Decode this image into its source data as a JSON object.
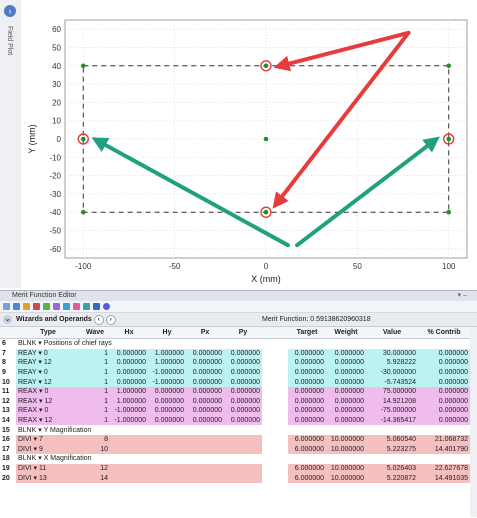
{
  "side_panel": {
    "label": "Field Plot"
  },
  "plot": {
    "xlabel": "X (mm)",
    "ylabel": "Y (mm)",
    "x_ticks": [
      "-100",
      "-50",
      "0",
      "50",
      "100"
    ],
    "y_ticks": [
      "60",
      "50",
      "40",
      "30",
      "20",
      "10",
      "0",
      "-10",
      "-20",
      "-30",
      "-40",
      "-50",
      "-60"
    ],
    "colors": {
      "points": "#1e8f2a",
      "circles": "#e23b3b",
      "red_arrow": "#e83c3c",
      "teal_arrow": "#20a07e"
    }
  },
  "chart_data": {
    "type": "scatter",
    "xlabel": "X (mm)",
    "ylabel": "Y (mm)",
    "xlim": [
      -110,
      110
    ],
    "ylim": [
      -65,
      65
    ],
    "points": [
      {
        "x": -100,
        "y": 40
      },
      {
        "x": 100,
        "y": 40
      },
      {
        "x": -100,
        "y": -40
      },
      {
        "x": 100,
        "y": -40
      },
      {
        "x": 0,
        "y": 0
      },
      {
        "x": -100,
        "y": 0
      },
      {
        "x": 100,
        "y": 0
      },
      {
        "x": 0,
        "y": 40
      },
      {
        "x": 0,
        "y": -40
      }
    ],
    "circled_points": [
      {
        "x": 0,
        "y": 40
      },
      {
        "x": 0,
        "y": -40
      },
      {
        "x": -100,
        "y": 0
      },
      {
        "x": 100,
        "y": 0
      }
    ],
    "dashed_rectangle": {
      "x": [
        -100,
        100
      ],
      "y": [
        -40,
        40
      ]
    },
    "grid": true
  },
  "editor": {
    "title": "Merit Function Editor",
    "wizard_label": "Wizards and Operands",
    "merit_label": "Merit Function:",
    "merit_value": "0.59138620960318",
    "headers": [
      "Type",
      "Wave",
      "Hx",
      "Hy",
      "Px",
      "Py",
      "Target",
      "Weight",
      "Value",
      "% Contrib"
    ],
    "rows": [
      {
        "n": "6",
        "kind": "blnk",
        "text": "BLNK ▾ Positions of chief rays"
      },
      {
        "n": "7",
        "kind": "cyan",
        "type": "REAY ▾ 0",
        "wave": "1",
        "hx": "0.000000",
        "hy": "1.000000",
        "px": "0.000000",
        "py": "0.000000",
        "target": "0.000000",
        "weight": "0.000000",
        "value": "30.000000",
        "contrib": "0.000000"
      },
      {
        "n": "8",
        "kind": "cyan",
        "type": "REAY ▾ 12",
        "wave": "1",
        "hx": "0.000000",
        "hy": "1.000000",
        "px": "0.000000",
        "py": "0.000000",
        "target": "0.000000",
        "weight": "0.000000",
        "value": "5.928222",
        "contrib": "0.000000"
      },
      {
        "n": "9",
        "kind": "cyan",
        "type": "REAY ▾ 0",
        "wave": "1",
        "hx": "0.000000",
        "hy": "-1.000000",
        "px": "0.000000",
        "py": "0.000000",
        "target": "0.000000",
        "weight": "0.000000",
        "value": "-30.000000",
        "contrib": "0.000000"
      },
      {
        "n": "10",
        "kind": "cyan",
        "type": "REAY ▾ 12",
        "wave": "1",
        "hx": "0.000000",
        "hy": "-1.000000",
        "px": "0.000000",
        "py": "0.000000",
        "target": "0.000000",
        "weight": "0.000000",
        "value": "-5.743524",
        "contrib": "0.000000"
      },
      {
        "n": "11",
        "kind": "mag",
        "type": "REAX ▾ 0",
        "wave": "1",
        "hx": "1.000000",
        "hy": "0.000000",
        "px": "0.000000",
        "py": "0.000000",
        "target": "0.000000",
        "weight": "0.000000",
        "value": "75.000000",
        "contrib": "0.000000"
      },
      {
        "n": "12",
        "kind": "mag",
        "type": "REAX ▾ 12",
        "wave": "1",
        "hx": "1.000000",
        "hy": "0.000000",
        "px": "0.000000",
        "py": "0.000000",
        "target": "0.000000",
        "weight": "0.000000",
        "value": "14.921208",
        "contrib": "0.000000"
      },
      {
        "n": "13",
        "kind": "mag",
        "type": "REAX ▾ 0",
        "wave": "1",
        "hx": "-1.000000",
        "hy": "0.000000",
        "px": "0.000000",
        "py": "0.000000",
        "target": "0.000000",
        "weight": "0.000000",
        "value": "-75.000000",
        "contrib": "0.000000"
      },
      {
        "n": "14",
        "kind": "mag",
        "type": "REAX ▾ 12",
        "wave": "1",
        "hx": "-1.000000",
        "hy": "0.000000",
        "px": "0.000000",
        "py": "0.000000",
        "target": "0.000000",
        "weight": "0.000000",
        "value": "-14.365417",
        "contrib": "0.000000"
      },
      {
        "n": "15",
        "kind": "blnk",
        "text": "BLNK ▾ Y Magnification"
      },
      {
        "n": "16",
        "kind": "pink",
        "type": "DIVI ▾ 7",
        "wave": "8",
        "hx": "",
        "hy": "",
        "px": "",
        "py": "",
        "target": "6.000000",
        "weight": "10.000000",
        "value": "5.060540",
        "contrib": "21.068732"
      },
      {
        "n": "17",
        "kind": "pink",
        "type": "DIVI ▾ 9",
        "wave": "10",
        "hx": "",
        "hy": "",
        "px": "",
        "py": "",
        "target": "6.000000",
        "weight": "10.000000",
        "value": "5.223275",
        "contrib": "14.401790"
      },
      {
        "n": "18",
        "kind": "blnk",
        "text": "BLNK ▾ X Magnification"
      },
      {
        "n": "19",
        "kind": "pink",
        "type": "DIVI ▾ 11",
        "wave": "12",
        "hx": "",
        "hy": "",
        "px": "",
        "py": "",
        "target": "6.000000",
        "weight": "10.000000",
        "value": "5.026403",
        "contrib": "22.627678"
      },
      {
        "n": "20",
        "kind": "pink",
        "type": "DIVI ▾ 13",
        "wave": "14",
        "hx": "",
        "hy": "",
        "px": "",
        "py": "",
        "target": "6.000000",
        "weight": "10.000000",
        "value": "5.220872",
        "contrib": "14.491035"
      }
    ]
  }
}
